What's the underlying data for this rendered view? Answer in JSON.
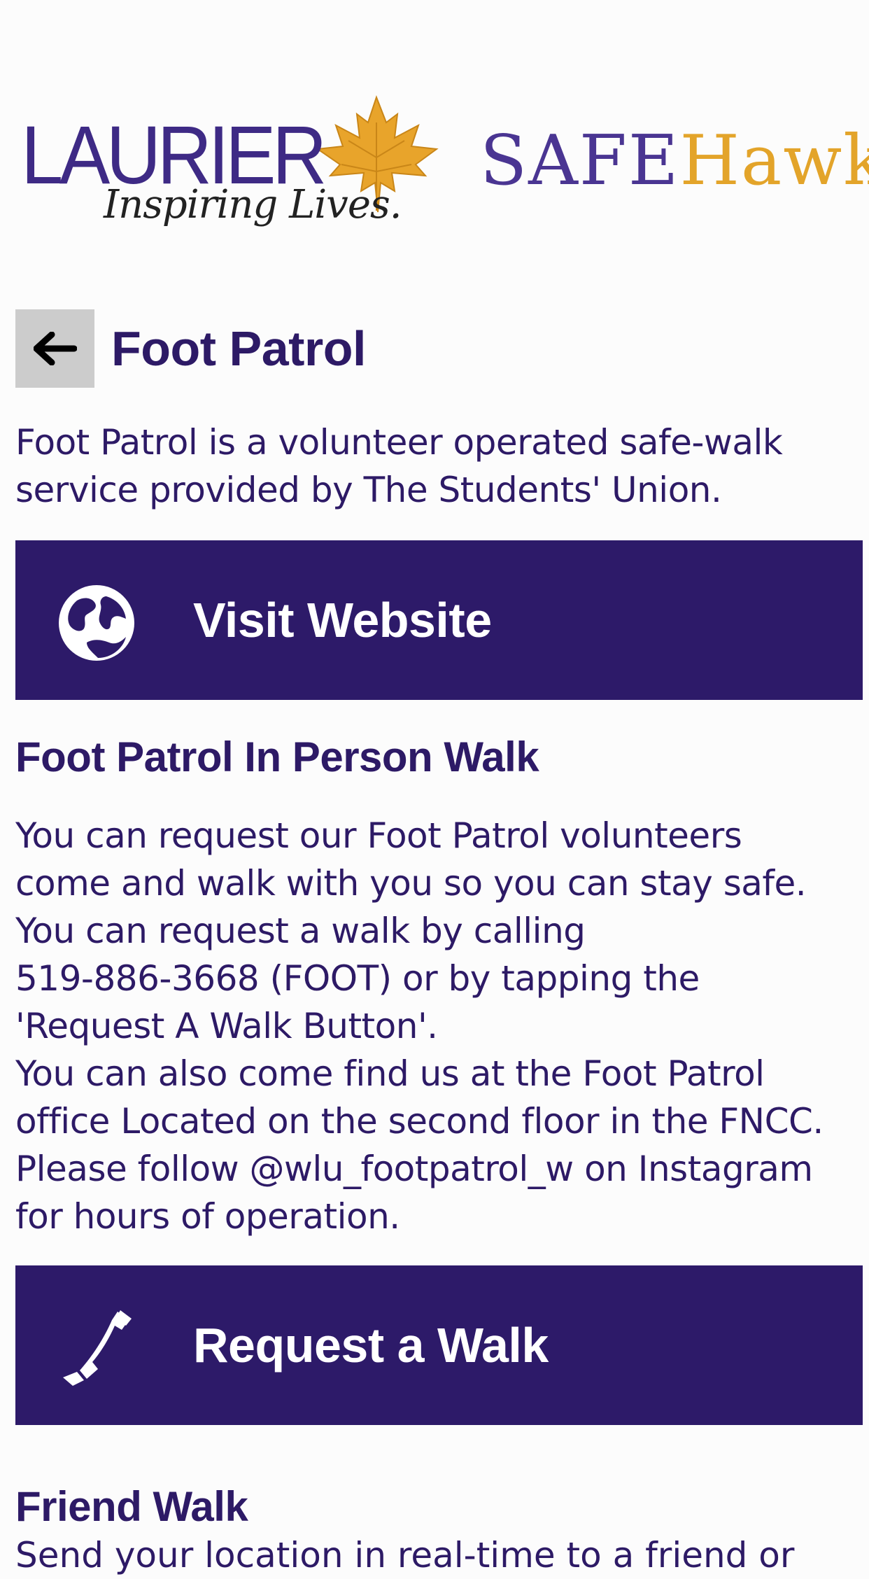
{
  "header": {
    "laurier_logo": {
      "wordmark": "LAURIER",
      "tagline": "Inspiring Lives.",
      "leaf_color": "#e8a42b",
      "text_color": "#3e2a85"
    },
    "safehawk_logo": {
      "part1": "SAFE",
      "part2": "Hawk",
      "part1_color": "#4a3592",
      "part2_color": "#e3a42a"
    }
  },
  "page": {
    "back_icon": "arrow-left-icon",
    "title": "Foot Patrol",
    "intro_lines": [
      "Foot Patrol is a volunteer operated safe-walk",
      "service provided by The Students' Union."
    ]
  },
  "visit_button": {
    "icon": "globe-icon",
    "label": "Visit Website"
  },
  "in_person": {
    "heading": "Foot Patrol In Person Walk",
    "lines": [
      "You can request our Foot Patrol volunteers",
      "come and walk with you so you can stay safe.",
      "You can request a walk by calling",
      "519-886-3668 (FOOT) or by tapping the",
      "'Request A Walk Button'.",
      "You can also come find us at the Foot Patrol",
      "office Located on the second floor in the FNCC.",
      "Please follow @wlu_footpatrol_w  on Instagram",
      "for hours of operation."
    ]
  },
  "walk_button": {
    "icon": "phone-icon",
    "label": "Request a Walk"
  },
  "friend_walk": {
    "heading": "Friend Walk",
    "partial_line": "Send your location in real-time to a friend or"
  },
  "colors": {
    "primary": "#2d1a69",
    "back_button_bg": "#cccccc",
    "background": "#fcfcfc"
  }
}
